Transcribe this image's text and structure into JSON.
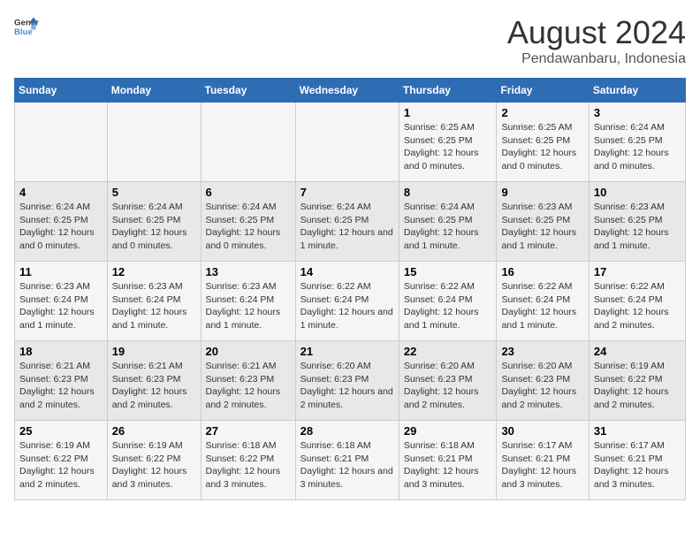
{
  "header": {
    "logo_line1": "General",
    "logo_line2": "Blue",
    "title": "August 2024",
    "subtitle": "Pendawanbaru, Indonesia"
  },
  "weekdays": [
    "Sunday",
    "Monday",
    "Tuesday",
    "Wednesday",
    "Thursday",
    "Friday",
    "Saturday"
  ],
  "rows": [
    [
      {
        "day": "",
        "sunrise": "",
        "sunset": "",
        "daylight": ""
      },
      {
        "day": "",
        "sunrise": "",
        "sunset": "",
        "daylight": ""
      },
      {
        "day": "",
        "sunrise": "",
        "sunset": "",
        "daylight": ""
      },
      {
        "day": "",
        "sunrise": "",
        "sunset": "",
        "daylight": ""
      },
      {
        "day": "1",
        "sunrise": "6:25 AM",
        "sunset": "6:25 PM",
        "daylight": "12 hours and 0 minutes."
      },
      {
        "day": "2",
        "sunrise": "6:25 AM",
        "sunset": "6:25 PM",
        "daylight": "12 hours and 0 minutes."
      },
      {
        "day": "3",
        "sunrise": "6:24 AM",
        "sunset": "6:25 PM",
        "daylight": "12 hours and 0 minutes."
      }
    ],
    [
      {
        "day": "4",
        "sunrise": "6:24 AM",
        "sunset": "6:25 PM",
        "daylight": "12 hours and 0 minutes."
      },
      {
        "day": "5",
        "sunrise": "6:24 AM",
        "sunset": "6:25 PM",
        "daylight": "12 hours and 0 minutes."
      },
      {
        "day": "6",
        "sunrise": "6:24 AM",
        "sunset": "6:25 PM",
        "daylight": "12 hours and 0 minutes."
      },
      {
        "day": "7",
        "sunrise": "6:24 AM",
        "sunset": "6:25 PM",
        "daylight": "12 hours and 1 minute."
      },
      {
        "day": "8",
        "sunrise": "6:24 AM",
        "sunset": "6:25 PM",
        "daylight": "12 hours and 1 minute."
      },
      {
        "day": "9",
        "sunrise": "6:23 AM",
        "sunset": "6:25 PM",
        "daylight": "12 hours and 1 minute."
      },
      {
        "day": "10",
        "sunrise": "6:23 AM",
        "sunset": "6:25 PM",
        "daylight": "12 hours and 1 minute."
      }
    ],
    [
      {
        "day": "11",
        "sunrise": "6:23 AM",
        "sunset": "6:24 PM",
        "daylight": "12 hours and 1 minute."
      },
      {
        "day": "12",
        "sunrise": "6:23 AM",
        "sunset": "6:24 PM",
        "daylight": "12 hours and 1 minute."
      },
      {
        "day": "13",
        "sunrise": "6:23 AM",
        "sunset": "6:24 PM",
        "daylight": "12 hours and 1 minute."
      },
      {
        "day": "14",
        "sunrise": "6:22 AM",
        "sunset": "6:24 PM",
        "daylight": "12 hours and 1 minute."
      },
      {
        "day": "15",
        "sunrise": "6:22 AM",
        "sunset": "6:24 PM",
        "daylight": "12 hours and 1 minute."
      },
      {
        "day": "16",
        "sunrise": "6:22 AM",
        "sunset": "6:24 PM",
        "daylight": "12 hours and 1 minute."
      },
      {
        "day": "17",
        "sunrise": "6:22 AM",
        "sunset": "6:24 PM",
        "daylight": "12 hours and 2 minutes."
      }
    ],
    [
      {
        "day": "18",
        "sunrise": "6:21 AM",
        "sunset": "6:23 PM",
        "daylight": "12 hours and 2 minutes."
      },
      {
        "day": "19",
        "sunrise": "6:21 AM",
        "sunset": "6:23 PM",
        "daylight": "12 hours and 2 minutes."
      },
      {
        "day": "20",
        "sunrise": "6:21 AM",
        "sunset": "6:23 PM",
        "daylight": "12 hours and 2 minutes."
      },
      {
        "day": "21",
        "sunrise": "6:20 AM",
        "sunset": "6:23 PM",
        "daylight": "12 hours and 2 minutes."
      },
      {
        "day": "22",
        "sunrise": "6:20 AM",
        "sunset": "6:23 PM",
        "daylight": "12 hours and 2 minutes."
      },
      {
        "day": "23",
        "sunrise": "6:20 AM",
        "sunset": "6:23 PM",
        "daylight": "12 hours and 2 minutes."
      },
      {
        "day": "24",
        "sunrise": "6:19 AM",
        "sunset": "6:22 PM",
        "daylight": "12 hours and 2 minutes."
      }
    ],
    [
      {
        "day": "25",
        "sunrise": "6:19 AM",
        "sunset": "6:22 PM",
        "daylight": "12 hours and 2 minutes."
      },
      {
        "day": "26",
        "sunrise": "6:19 AM",
        "sunset": "6:22 PM",
        "daylight": "12 hours and 3 minutes."
      },
      {
        "day": "27",
        "sunrise": "6:18 AM",
        "sunset": "6:22 PM",
        "daylight": "12 hours and 3 minutes."
      },
      {
        "day": "28",
        "sunrise": "6:18 AM",
        "sunset": "6:21 PM",
        "daylight": "12 hours and 3 minutes."
      },
      {
        "day": "29",
        "sunrise": "6:18 AM",
        "sunset": "6:21 PM",
        "daylight": "12 hours and 3 minutes."
      },
      {
        "day": "30",
        "sunrise": "6:17 AM",
        "sunset": "6:21 PM",
        "daylight": "12 hours and 3 minutes."
      },
      {
        "day": "31",
        "sunrise": "6:17 AM",
        "sunset": "6:21 PM",
        "daylight": "12 hours and 3 minutes."
      }
    ]
  ]
}
